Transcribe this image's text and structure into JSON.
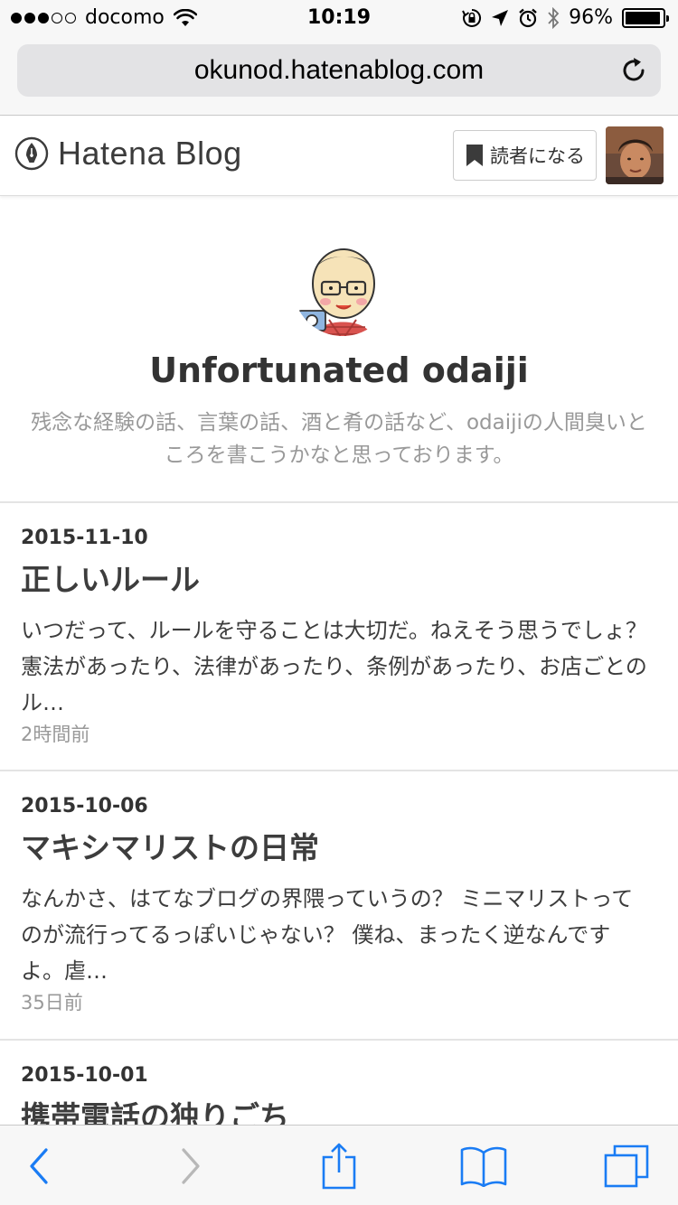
{
  "status_bar": {
    "carrier": "docomo",
    "signal_bars_filled": 3,
    "signal_bars_total": 5,
    "time": "10:19",
    "battery_percent": "96%",
    "battery_level": 0.96
  },
  "browser": {
    "url": "okunod.hatenablog.com",
    "toolbar_icons": [
      "back-icon",
      "forward-icon",
      "share-icon",
      "bookmarks-icon",
      "tabs-icon"
    ]
  },
  "header": {
    "logo_text": "Hatena Blog",
    "subscribe_label": "読者になる"
  },
  "blog": {
    "title": "Unfortunated odaiji",
    "description": "残念な経験の話、言葉の話、酒と肴の話など、odaijiの人間臭いところを書こうかなと思っております。"
  },
  "entries": [
    {
      "date": "2015-11-10",
      "title": "正しいルール",
      "excerpt": "いつだって、ルールを守ることは大切だ。ねえそう思うでしょ？ 憲法があったり、法律があったり、条例があったり、お店ごとのル…",
      "time_ago": "2時間前"
    },
    {
      "date": "2015-10-06",
      "title": "マキシマリストの日常",
      "excerpt": "なんかさ、はてなブログの界隈っていうの？ ミニマリストってのが流行ってるっぽいじゃない？ 僕ね、まったく逆なんですよ。虐…",
      "time_ago": "35日前"
    },
    {
      "date": "2015-10-01",
      "title": "携帯電話の独りごち"
    }
  ],
  "colors": {
    "accent": "#1a7cf4",
    "muted_text": "#999999",
    "body_text": "#333333"
  }
}
